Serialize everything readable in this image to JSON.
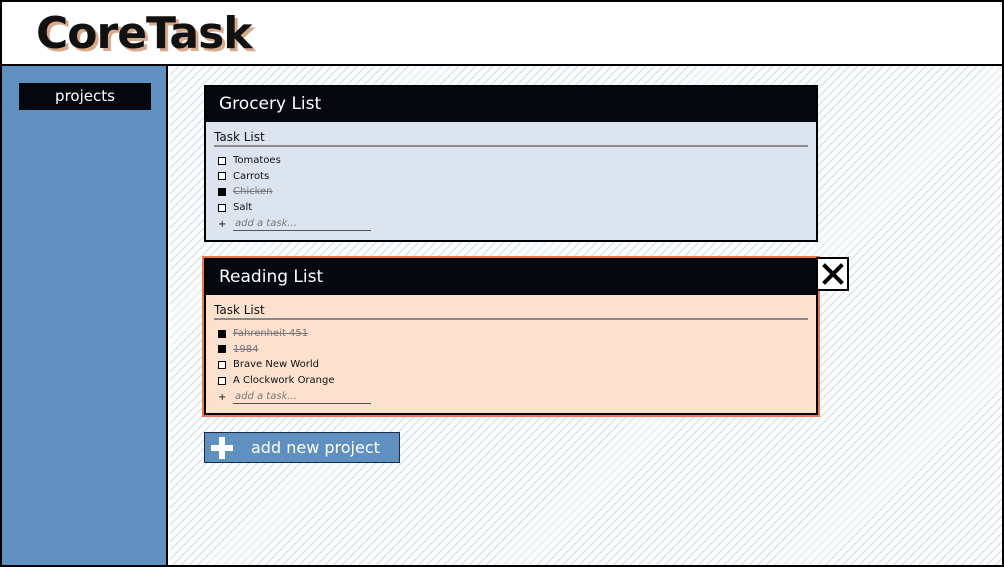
{
  "app": {
    "logo": "CoreTask"
  },
  "sidebar": {
    "items": [
      {
        "label": "projects"
      }
    ]
  },
  "projects": [
    {
      "title": "Grocery List",
      "section_title": "Task List",
      "tasks": [
        {
          "text": "Tomatoes",
          "done": false
        },
        {
          "text": "Carrots",
          "done": false
        },
        {
          "text": "Chicken",
          "done": true
        },
        {
          "text": "Salt",
          "done": false
        }
      ],
      "add_task": {
        "symbol": "+",
        "placeholder": "add a task..."
      }
    },
    {
      "title": "Reading List",
      "section_title": "Task List",
      "tasks": [
        {
          "text": "Fahrenheit 451",
          "done": true
        },
        {
          "text": "1984",
          "done": true
        },
        {
          "text": "Brave New World",
          "done": false
        },
        {
          "text": "A Clockwork Orange",
          "done": false
        }
      ],
      "add_task": {
        "symbol": "+",
        "placeholder": "add a task..."
      }
    }
  ],
  "actions": {
    "add_project_label": "add new project",
    "close_icon": "close-icon"
  },
  "colors": {
    "sidebar": "#6090c0",
    "header_dark": "#05080e",
    "grocery_card": "#dce4ef",
    "reading_card": "#fde1cf",
    "reading_outline": "#e57a50"
  }
}
